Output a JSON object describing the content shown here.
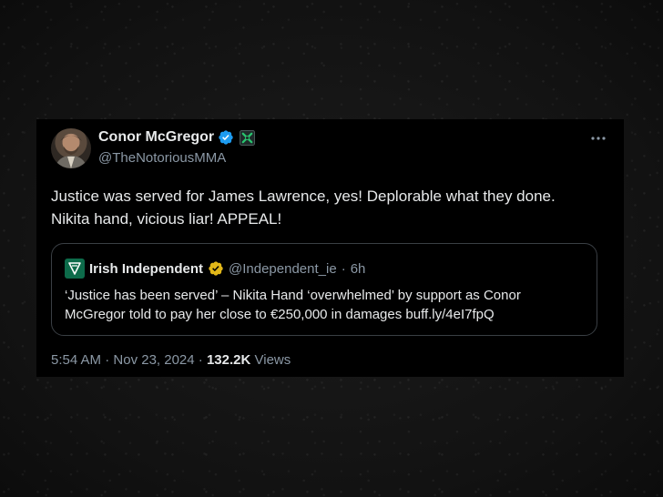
{
  "tweet": {
    "author": {
      "display_name": "Conor McGregor",
      "handle": "@TheNotoriousMMA",
      "verified": true
    },
    "text_line1": "Justice was served for James Lawrence, yes! Deplorable what they done.",
    "text_line2": "Nikita hand, vicious liar! APPEAL!",
    "quoted": {
      "display_name": "Irish Independent",
      "handle": "@Independent_ie",
      "separator": "·",
      "time_ago": "6h",
      "text_line1": "‘Justice has been served’ – Nikita Hand ‘overwhelmed’ by support as Conor",
      "text_line2": "McGregor told to pay her close to €250,000 in damages buff.ly/4eI7fpQ"
    },
    "time": "5:54 AM",
    "dot1": "·",
    "date": "Nov 23, 2024",
    "dot2": "·",
    "views_count": "132.2K",
    "views_label": "Views"
  },
  "icons": {
    "verified": "verified-icon",
    "affiliate": "affiliate-badge-icon",
    "more": "more-icon",
    "quote_logo": "irish-independent-logo",
    "gold_verified": "gold-verified-icon"
  },
  "colors": {
    "card_background": "#000000",
    "page_background": "#161616",
    "primary_text": "#e7e9ea",
    "secondary_text": "#8b98a5",
    "verified_blue": "#1d9bf0",
    "gold_badge": "#e2b719",
    "border": "#3a3f44"
  }
}
